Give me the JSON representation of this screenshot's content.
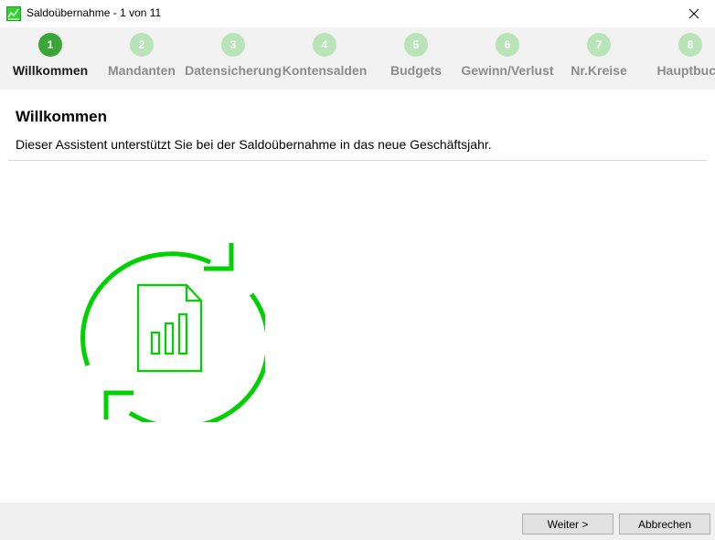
{
  "window": {
    "title": "Saldoübernahme - 1 von 11"
  },
  "steps": [
    {
      "number": "1",
      "label": "Willkommen",
      "active": true
    },
    {
      "number": "2",
      "label": "Mandanten",
      "active": false
    },
    {
      "number": "3",
      "label": "Datensicherung",
      "active": false
    },
    {
      "number": "4",
      "label": "Kontensalden",
      "active": false
    },
    {
      "number": "5",
      "label": "Budgets",
      "active": false
    },
    {
      "number": "6",
      "label": "Gewinn/Verlust",
      "active": false
    },
    {
      "number": "7",
      "label": "Nr.Kreise",
      "active": false
    },
    {
      "number": "8",
      "label": "Hauptbuch",
      "active": false
    }
  ],
  "content": {
    "title": "Willkommen",
    "description": "Dieser Assistent unterstützt Sie bei der Saldoübernahme in das neue Geschäftsjahr.",
    "illustration_icon": "refresh-document-chart-icon"
  },
  "footer": {
    "next_label": "Weiter >",
    "cancel_label": "Abbrechen"
  },
  "colors": {
    "accent": "#00d100",
    "step_active": "#3aa63a",
    "step_inactive": "#b8e4b8"
  }
}
